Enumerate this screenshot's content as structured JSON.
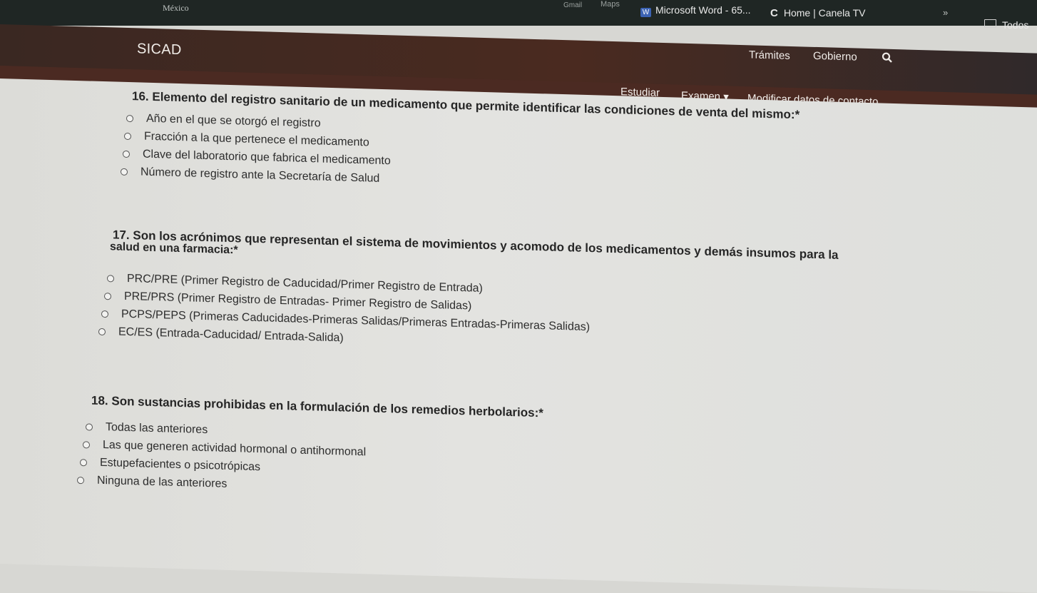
{
  "bookmarks": {
    "mexico": "México",
    "gmail": "Gmail",
    "maps": "Maps",
    "word": "Microsoft Word - 65...",
    "canela": "Home | Canela TV",
    "more": "»",
    "todos": "Todos"
  },
  "header": {
    "site": "SICAD",
    "nav": [
      "Trámites",
      "Gobierno"
    ],
    "search_icon": "search-icon"
  },
  "subnav": {
    "items": [
      "Estudiar",
      "Examen ▾",
      "Modificar datos de contacto"
    ]
  },
  "questions": [
    {
      "title": "16. Elemento del registro sanitario de un medicamento que permite identificar las condiciones de venta del mismo:*",
      "options": [
        "Año en el que se otorgó el registro",
        "Fracción a la que pertenece el medicamento",
        "Clave del laboratorio que fabrica el medicamento",
        "Número de registro ante la Secretaría de Salud"
      ]
    },
    {
      "title_line1": "17. Son los acrónimos que representan el sistema de movimientos y acomodo de los medicamentos y demás insumos para la",
      "title_line2": "salud en una farmacia:*",
      "options": [
        "PRC/PRE (Primer Registro de Caducidad/Primer Registro de Entrada)",
        "PRE/PRS (Primer Registro de Entradas- Primer Registro de Salidas)",
        "PCPS/PEPS (Primeras Caducidades-Primeras Salidas/Primeras Entradas-Primeras Salidas)",
        "EC/ES (Entrada-Caducidad/ Entrada-Salida)"
      ]
    },
    {
      "title": "18. Son sustancias prohibidas en la formulación de los remedios herbolarios:*",
      "options": [
        "Todas las anteriores",
        "Las que generen actividad hormonal o antihormonal",
        "Estupefacientes o psicotrópicas",
        "Ninguna de las anteriores"
      ]
    }
  ]
}
